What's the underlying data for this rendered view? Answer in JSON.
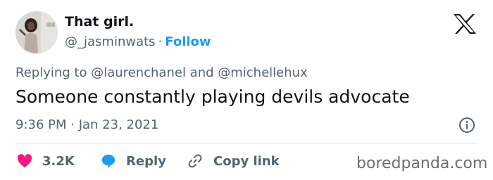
{
  "author": {
    "display_name": "That girl.",
    "handle": "@_jasminwats",
    "separator": "·",
    "follow_label": "Follow"
  },
  "reply_context": "Replying to @laurenchanel and @michellehux",
  "tweet_text": "Someone constantly playing devils advocate",
  "timestamp": "9:36 PM · Jan 23, 2021",
  "actions": {
    "likes_count": "3.2K",
    "reply_label": "Reply",
    "copy_link_label": "Copy link"
  },
  "watermark": "boredpanda.com",
  "colors": {
    "accent": "#1d9bf0",
    "like": "#f91880",
    "text": "#0f1419",
    "muted": "#536471"
  },
  "icons": [
    "x-logo-icon",
    "info-icon",
    "heart-icon",
    "reply-bubble-icon",
    "link-icon"
  ]
}
